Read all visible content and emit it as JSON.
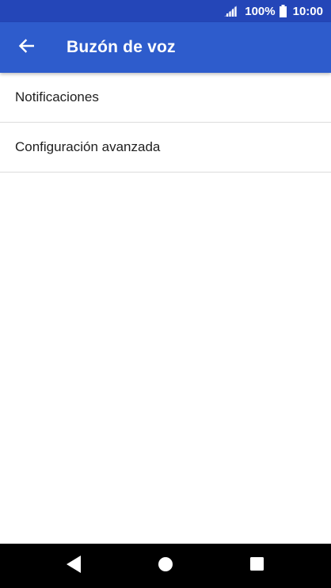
{
  "status_bar": {
    "battery_percent": "100%",
    "time": "10:00",
    "icons": [
      "signal-icon",
      "battery-icon"
    ]
  },
  "app_bar": {
    "title": "Buzón de voz",
    "back_icon": "arrow-back-icon"
  },
  "settings": {
    "items": [
      {
        "label": "Notificaciones"
      },
      {
        "label": "Configuración avanzada"
      }
    ]
  },
  "nav_bar": {
    "icons": [
      "nav-back-icon",
      "nav-home-icon",
      "nav-recents-icon"
    ]
  },
  "colors": {
    "status_bar": "#2446b8",
    "app_bar": "#2e5ccc",
    "nav_bar": "#000000",
    "divider": "#dcdcdc",
    "text": "#212121"
  }
}
